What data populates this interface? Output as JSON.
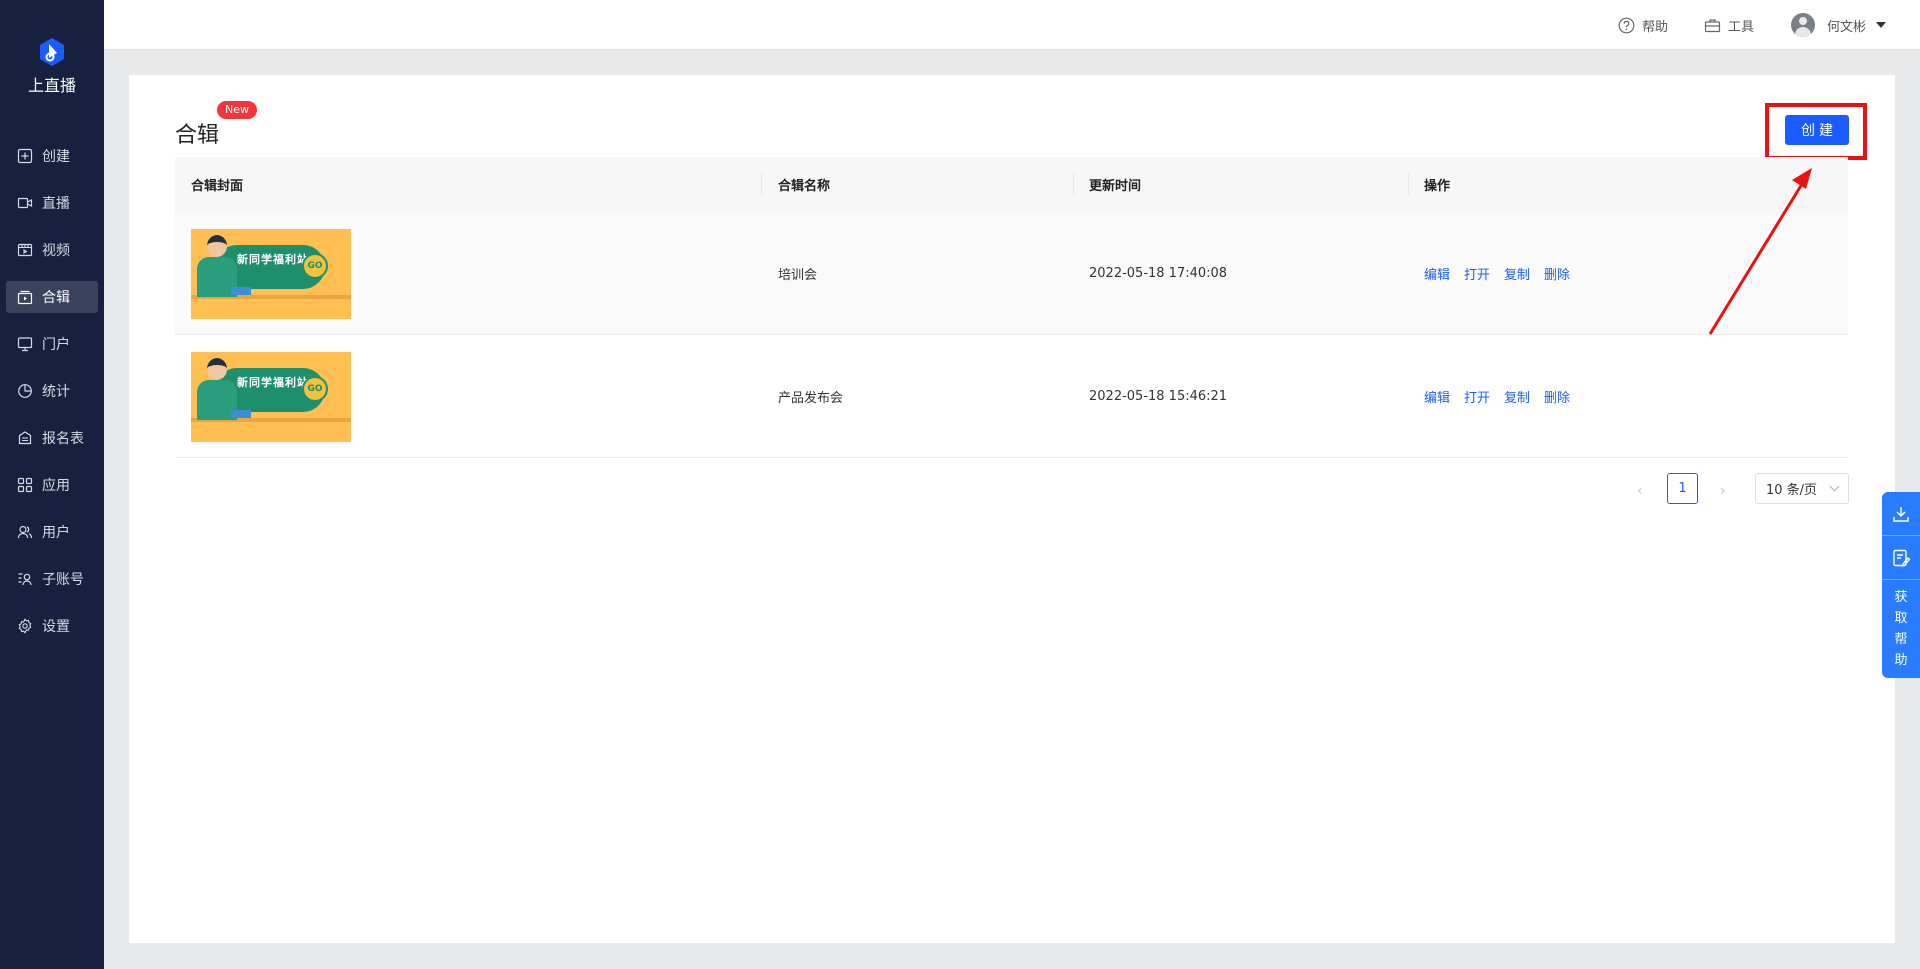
{
  "brand": {
    "name": "上直播"
  },
  "sidebar": {
    "items": [
      {
        "label": "创建",
        "icon": "plus-square-icon",
        "active": false
      },
      {
        "label": "直播",
        "icon": "video-camera-icon",
        "active": false
      },
      {
        "label": "视频",
        "icon": "film-icon",
        "active": false
      },
      {
        "label": "合辑",
        "icon": "collection-icon",
        "active": true
      },
      {
        "label": "门户",
        "icon": "monitor-icon",
        "active": false
      },
      {
        "label": "统计",
        "icon": "pie-chart-icon",
        "active": false
      },
      {
        "label": "报名表",
        "icon": "form-icon",
        "active": false
      },
      {
        "label": "应用",
        "icon": "apps-grid-icon",
        "active": false
      },
      {
        "label": "用户",
        "icon": "users-icon",
        "active": false
      },
      {
        "label": "子账号",
        "icon": "sub-account-icon",
        "active": false
      },
      {
        "label": "设置",
        "icon": "gear-icon",
        "active": false
      }
    ]
  },
  "header": {
    "help_label": "帮助",
    "tools_label": "工具",
    "user_name": "何文彬"
  },
  "main": {
    "title": "合辑",
    "new_badge": "New",
    "create_button": "创建",
    "table": {
      "columns": [
        "合辑封面",
        "合辑名称",
        "更新时间",
        "操作"
      ],
      "rows": [
        {
          "cover_text": "新同学福利站",
          "cover_go": "GO",
          "name": "培训会",
          "updated": "2022-05-18 17:40:08",
          "actions": [
            "编辑",
            "打开",
            "复制",
            "删除"
          ]
        },
        {
          "cover_text": "新同学福利站",
          "cover_go": "GO",
          "name": "产品发布会",
          "updated": "2022-05-18 15:46:21",
          "actions": [
            "编辑",
            "打开",
            "复制",
            "删除"
          ]
        }
      ]
    },
    "pagination": {
      "prev": "‹",
      "current_page": "1",
      "next": "›",
      "page_size": "10 条/页"
    }
  },
  "float_panel": {
    "help_chars": [
      "获",
      "取",
      "帮",
      "助"
    ]
  },
  "colors": {
    "sidebar_bg": "#17213f",
    "primary": "#1a5cff",
    "highlight": "#ec1010",
    "badge": "#f5353a"
  }
}
